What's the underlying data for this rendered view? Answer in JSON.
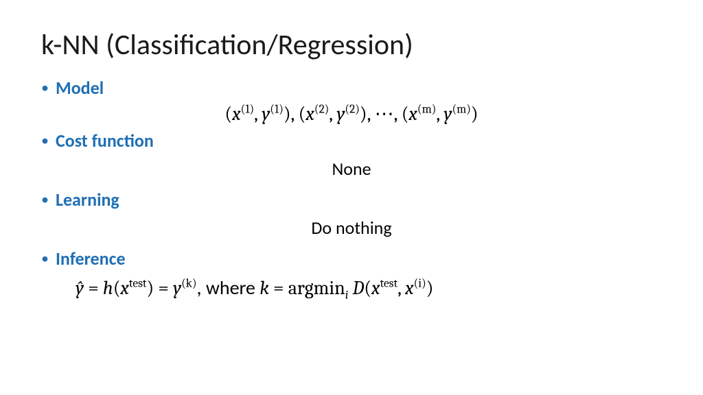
{
  "title": "k-NN (Classification/Regression)",
  "sections": {
    "model": {
      "label": "Model"
    },
    "cost": {
      "label": "Cost function",
      "value": "None"
    },
    "learning": {
      "label": "Learning",
      "value": "Do nothing"
    },
    "inference": {
      "label": "Inference"
    }
  },
  "math": {
    "x": "x",
    "y": "y",
    "yhat": "ŷ",
    "h": "h",
    "k": "k",
    "i": "i",
    "D": "D",
    "m": "m",
    "test": "test",
    "argmin": "argmin",
    "where": ", where ",
    "eq": " = ",
    "comma": ", ",
    "ellipsis": "⋯",
    "lp": "(",
    "rp": ")",
    "sup1": "(1)",
    "sup2": "(2)",
    "supm": "(m)",
    "supk": "(k)",
    "supi": "(i)"
  }
}
